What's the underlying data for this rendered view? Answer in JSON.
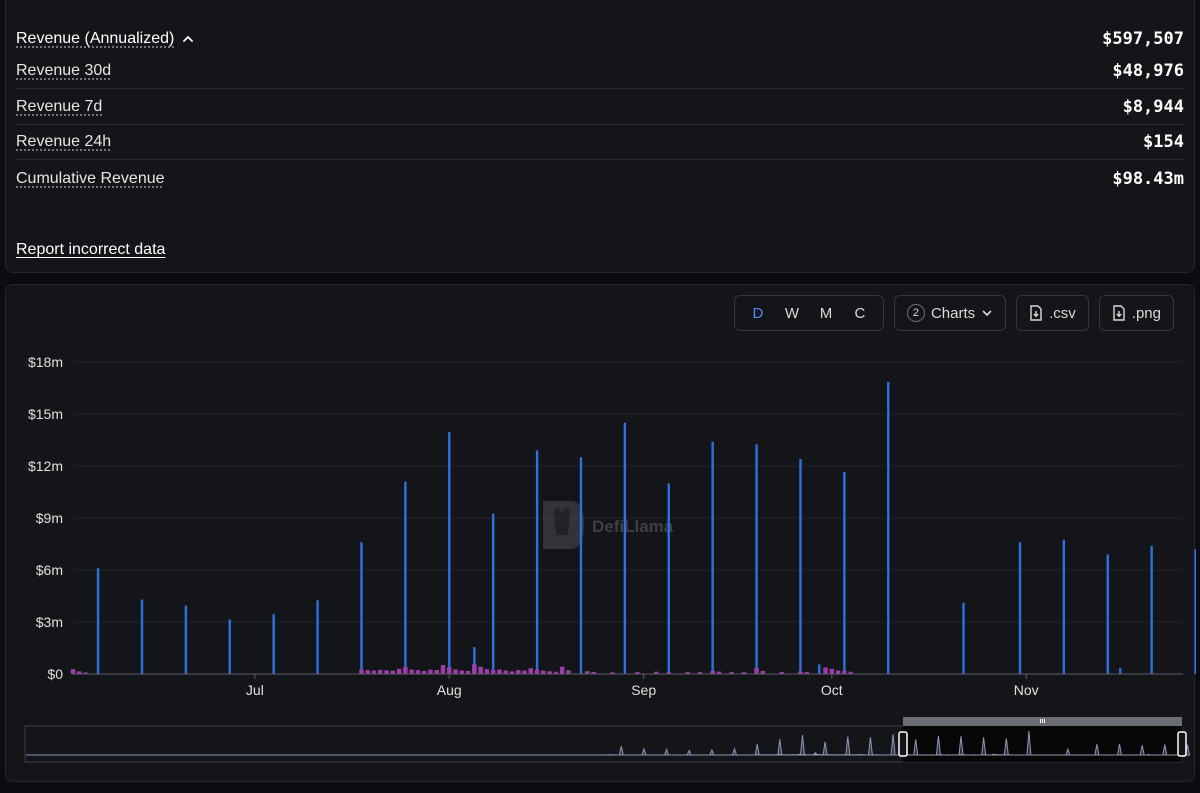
{
  "stats": {
    "annualized": {
      "label": "Revenue (Annualized)",
      "value": "$597,507"
    },
    "rev30d": {
      "label": "Revenue 30d",
      "value": "$48,976"
    },
    "rev7d": {
      "label": "Revenue 7d",
      "value": "$8,944"
    },
    "rev24h": {
      "label": "Revenue 24h",
      "value": "$154"
    },
    "cumulative": {
      "label": "Cumulative Revenue",
      "value": "$98.43m"
    }
  },
  "report_link": "Report incorrect data",
  "toolbar": {
    "granularity": [
      "D",
      "W",
      "M",
      "C"
    ],
    "active_granularity": "D",
    "charts_count": "2",
    "charts_label": "Charts",
    "csv_label": ".csv",
    "png_label": ".png"
  },
  "watermark": "DefiLlama",
  "colors": {
    "primary_series": "#2f6fe0",
    "secondary_series": "#9b3fa8",
    "accent": "#4f8df5"
  },
  "chart_data": {
    "type": "bar",
    "y_ticks": [
      "$0",
      "$3m",
      "$6m",
      "$9m",
      "$12m",
      "$15m",
      "$18m"
    ],
    "ylim": [
      0,
      18000000
    ],
    "x_ticks": [
      "Jul",
      "Aug",
      "Sep",
      "Oct",
      "Nov"
    ],
    "x_start": "2024-06-02",
    "x_end": "2024-11-26",
    "grid": true,
    "series": [
      {
        "color": "#2f6fe0",
        "points": [
          [
            "2024-06-06",
            6100000
          ],
          [
            "2024-06-13",
            4300000
          ],
          [
            "2024-06-20",
            3950000
          ],
          [
            "2024-06-27",
            3150000
          ],
          [
            "2024-07-04",
            3450000
          ],
          [
            "2024-07-11",
            4250000
          ],
          [
            "2024-07-18",
            7600000
          ],
          [
            "2024-07-25",
            11100000
          ],
          [
            "2024-08-01",
            13950000
          ],
          [
            "2024-08-05",
            1550000
          ],
          [
            "2024-08-08",
            9250000
          ],
          [
            "2024-08-15",
            12900000
          ],
          [
            "2024-08-22",
            12500000
          ],
          [
            "2024-08-29",
            14500000
          ],
          [
            "2024-09-05",
            11000000
          ],
          [
            "2024-09-12",
            13400000
          ],
          [
            "2024-09-19",
            13250000
          ],
          [
            "2024-09-26",
            12400000
          ],
          [
            "2024-09-29",
            550000
          ],
          [
            "2024-10-03",
            11650000
          ],
          [
            "2024-10-10",
            16850000
          ],
          [
            "2024-10-22",
            4100000
          ],
          [
            "2024-10-31",
            7600000
          ],
          [
            "2024-11-07",
            7750000
          ],
          [
            "2024-11-14",
            6900000
          ],
          [
            "2024-11-16",
            350000
          ],
          [
            "2024-11-21",
            7400000
          ],
          [
            "2024-11-28",
            7200000
          ]
        ]
      },
      {
        "color": "#9b3fa8",
        "points": [
          [
            "2024-06-02",
            280000
          ],
          [
            "2024-06-03",
            150000
          ],
          [
            "2024-06-04",
            90000
          ],
          [
            "2024-07-18",
            250000
          ],
          [
            "2024-07-19",
            220000
          ],
          [
            "2024-07-20",
            200000
          ],
          [
            "2024-07-21",
            240000
          ],
          [
            "2024-07-22",
            210000
          ],
          [
            "2024-07-23",
            190000
          ],
          [
            "2024-07-24",
            300000
          ],
          [
            "2024-07-25",
            420000
          ],
          [
            "2024-07-26",
            260000
          ],
          [
            "2024-07-27",
            220000
          ],
          [
            "2024-07-28",
            180000
          ],
          [
            "2024-07-29",
            250000
          ],
          [
            "2024-07-30",
            230000
          ],
          [
            "2024-07-31",
            520000
          ],
          [
            "2024-08-01",
            380000
          ],
          [
            "2024-08-02",
            260000
          ],
          [
            "2024-08-03",
            200000
          ],
          [
            "2024-08-04",
            180000
          ],
          [
            "2024-08-05",
            560000
          ],
          [
            "2024-08-06",
            420000
          ],
          [
            "2024-08-07",
            280000
          ],
          [
            "2024-08-08",
            230000
          ],
          [
            "2024-08-09",
            260000
          ],
          [
            "2024-08-10",
            200000
          ],
          [
            "2024-08-11",
            150000
          ],
          [
            "2024-08-12",
            230000
          ],
          [
            "2024-08-13",
            200000
          ],
          [
            "2024-08-14",
            330000
          ],
          [
            "2024-08-15",
            250000
          ],
          [
            "2024-08-16",
            200000
          ],
          [
            "2024-08-17",
            160000
          ],
          [
            "2024-08-18",
            130000
          ],
          [
            "2024-08-19",
            420000
          ],
          [
            "2024-08-20",
            220000
          ],
          [
            "2024-08-23",
            160000
          ],
          [
            "2024-08-24",
            120000
          ],
          [
            "2024-08-27",
            100000
          ],
          [
            "2024-08-31",
            110000
          ],
          [
            "2024-09-03",
            130000
          ],
          [
            "2024-09-05",
            100000
          ],
          [
            "2024-09-08",
            110000
          ],
          [
            "2024-09-10",
            120000
          ],
          [
            "2024-09-12",
            180000
          ],
          [
            "2024-09-13",
            140000
          ],
          [
            "2024-09-15",
            120000
          ],
          [
            "2024-09-17",
            100000
          ],
          [
            "2024-09-19",
            350000
          ],
          [
            "2024-09-20",
            180000
          ],
          [
            "2024-09-23",
            120000
          ],
          [
            "2024-09-26",
            150000
          ],
          [
            "2024-09-27",
            110000
          ],
          [
            "2024-09-30",
            380000
          ],
          [
            "2024-10-01",
            300000
          ],
          [
            "2024-10-02",
            200000
          ],
          [
            "2024-10-03",
            180000
          ],
          [
            "2024-10-04",
            130000
          ]
        ]
      }
    ]
  }
}
